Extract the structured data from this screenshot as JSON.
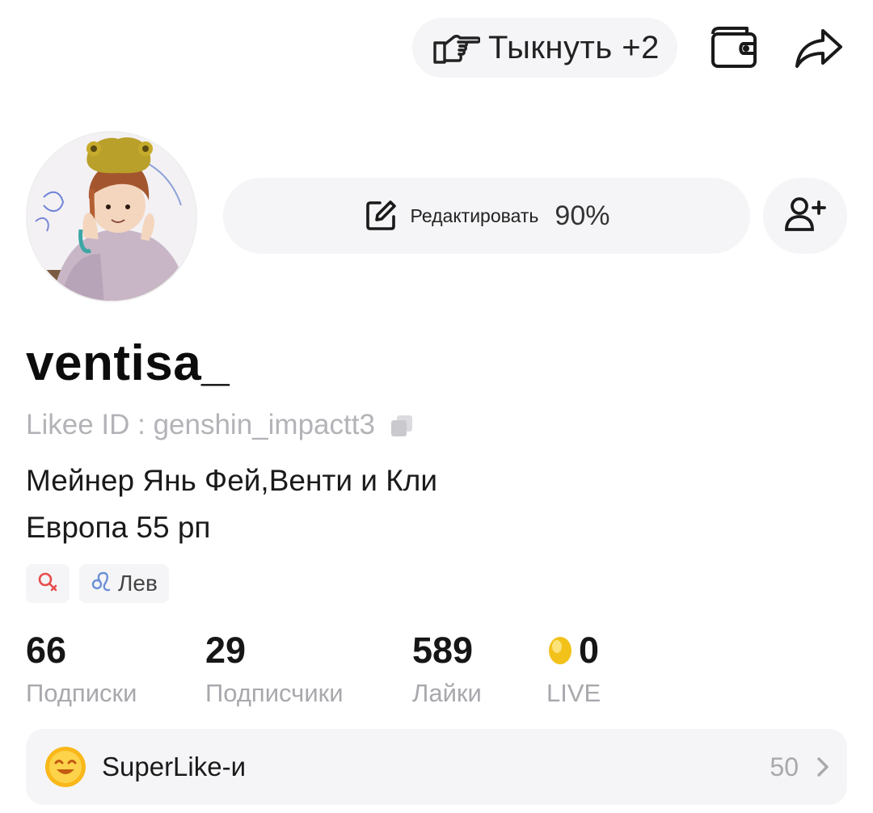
{
  "header": {
    "poke_label": "Тыкнуть +2",
    "icons": [
      "pointing-hand-icon",
      "wallet-icon",
      "share-icon"
    ]
  },
  "profile": {
    "edit_label": "Редактировать",
    "edit_percent": "90%",
    "username": "ventisa_",
    "likee_id": "Likee ID : genshin_impactt3",
    "bio_line1": "Мейнер Янь Фей,Венти и Кли",
    "bio_line2": "Европа 55 рп",
    "tags": [
      {
        "icon": "gender-icon",
        "label": ""
      },
      {
        "icon": "leo-zodiac-icon",
        "label": "Лев"
      }
    ]
  },
  "stats": [
    {
      "value": "66",
      "label": "Подписки"
    },
    {
      "value": "29",
      "label": "Подписчики"
    },
    {
      "value": "589",
      "label": "Лайки"
    },
    {
      "value": "0",
      "label": "LIVE"
    }
  ],
  "superlike": {
    "label": "SuperLike-и",
    "count": "50"
  },
  "colors": {
    "pill_bg": "#f5f5f7",
    "muted_text": "#a8a8ad",
    "coin_yellow": "#f2c21b",
    "gender_red": "#e74c4c",
    "zodiac_blue": "#6b8fd6"
  }
}
